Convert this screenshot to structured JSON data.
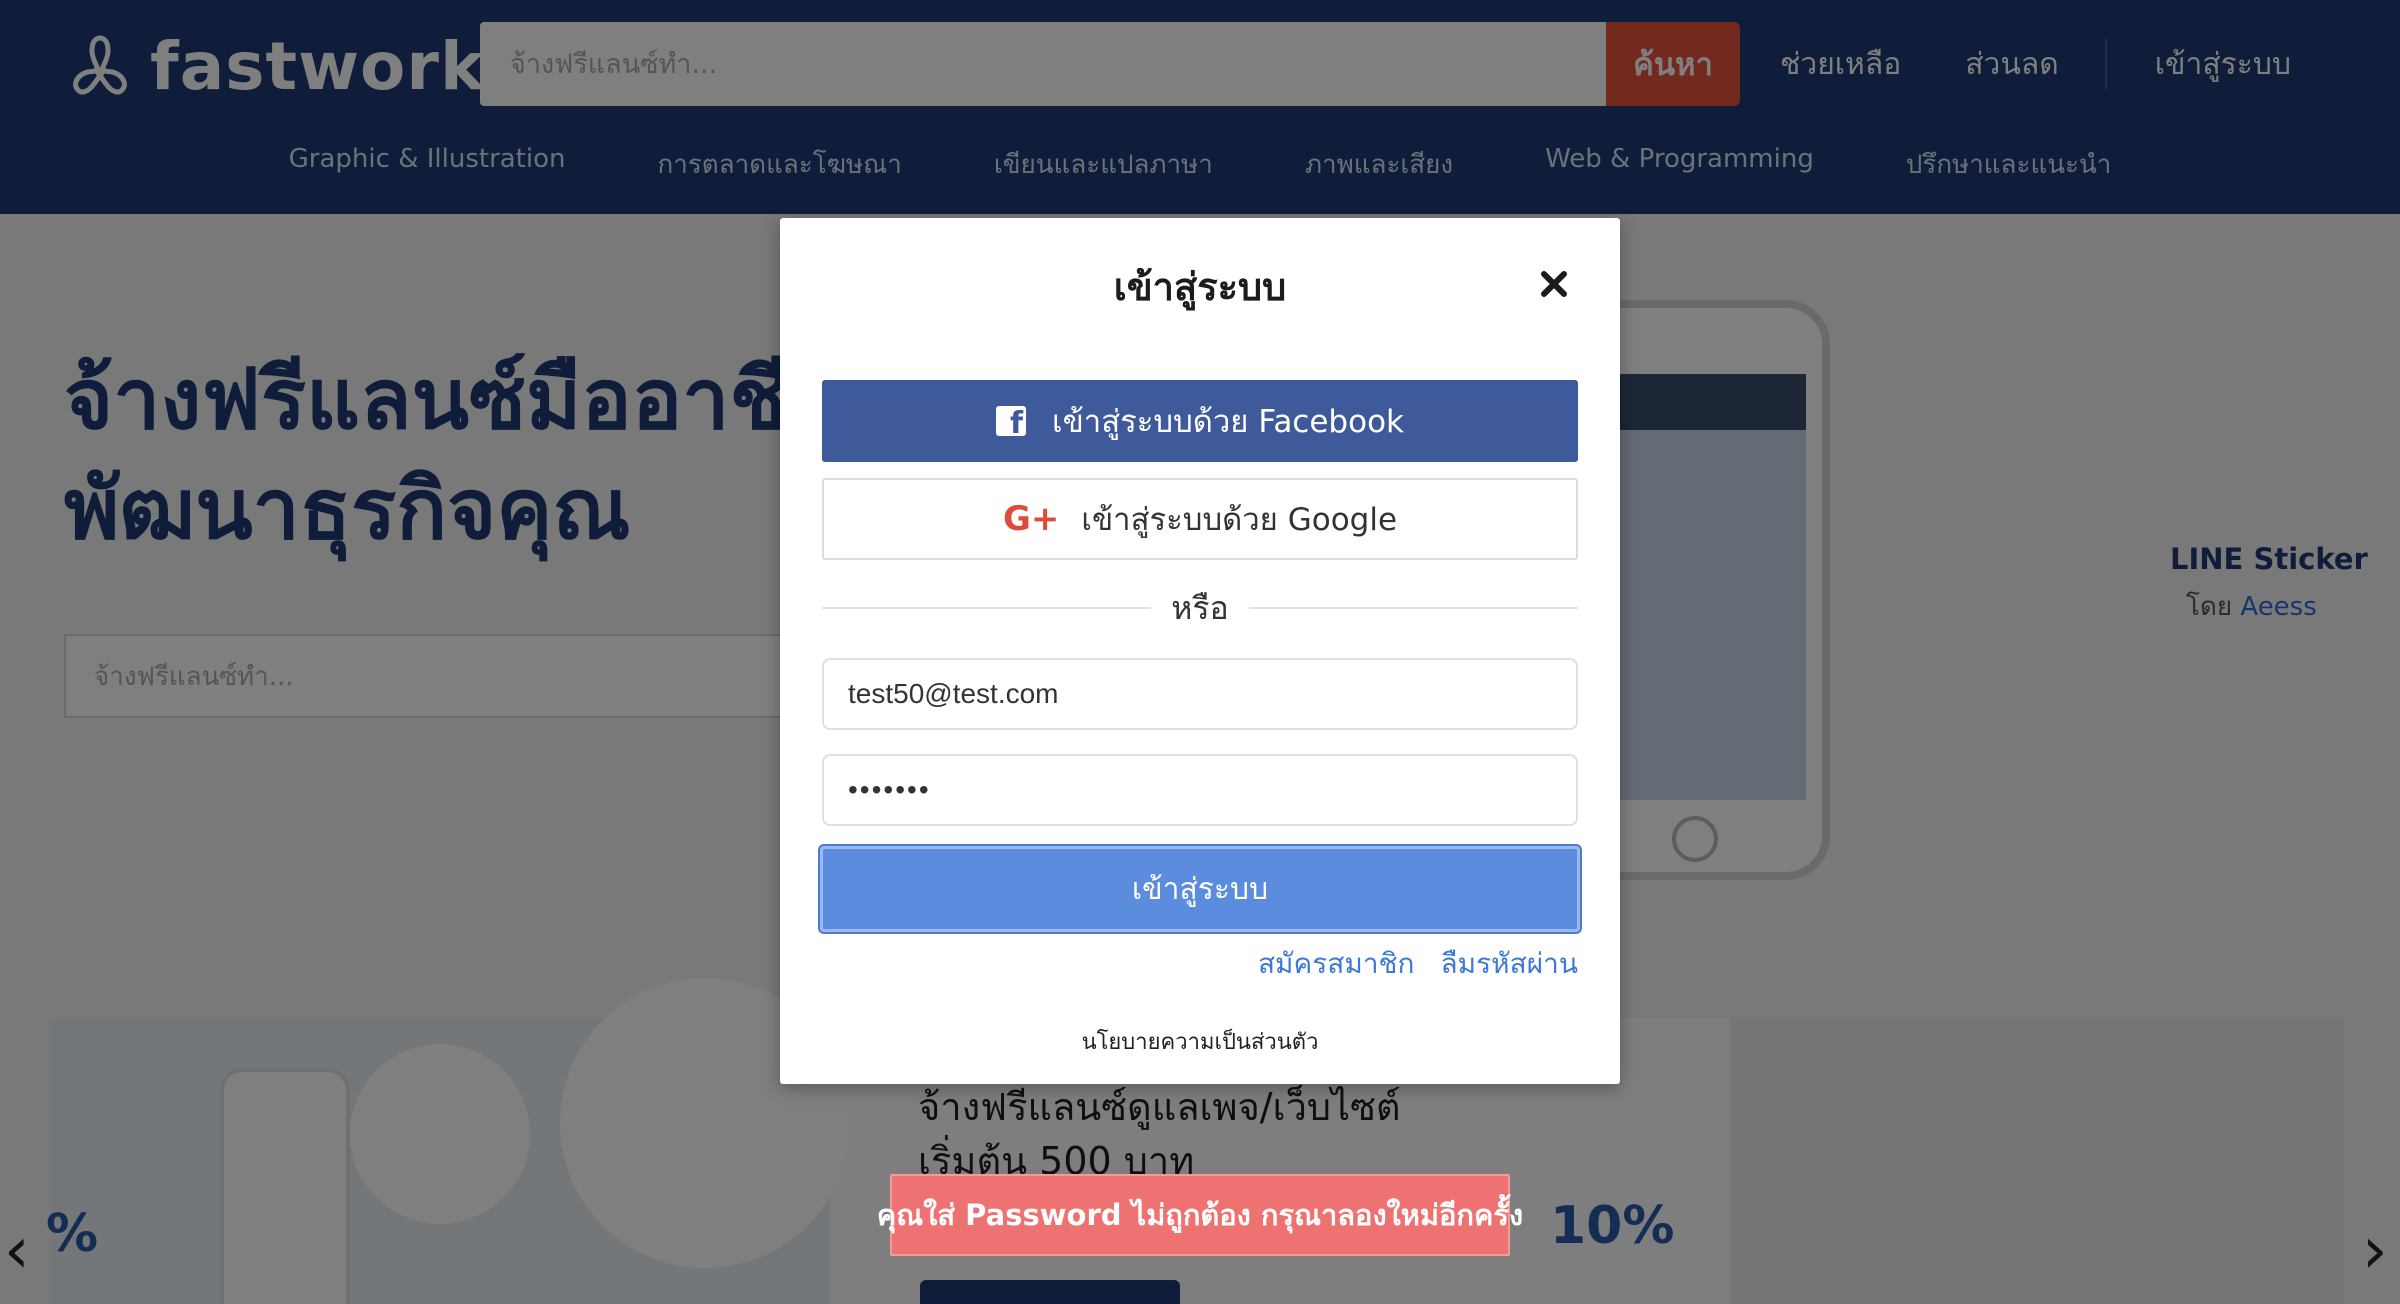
{
  "header": {
    "brand": "fastwork",
    "search_placeholder": "จ้างฟรีแลนซ์ทำ...",
    "search_button": "ค้นหา",
    "links": {
      "help": "ช่วยเหลือ",
      "discount": "ส่วนลด",
      "login": "เข้าสู่ระบบ"
    },
    "categories": [
      "Graphic & Illustration",
      "การตลาดและโฆษณา",
      "เขียนและแปลภาษา",
      "ภาพและเสียง",
      "Web & Programming",
      "ปรึกษาและแนะนำ"
    ]
  },
  "hero": {
    "title_line1": "จ้างฟรีแลนซ์มืออาชี",
    "title_line2": "พัฒนาธุรกิจคุณ",
    "search_placeholder": "จ้างฟรีแลนซ์ทำ...",
    "showcase": {
      "title": "LINE Sticker",
      "by_label": "โดย",
      "author": "Aeess"
    }
  },
  "banner": {
    "headline_line1": "จ้างฟรีแลนซ์ดูแลเพจ/เว็บไซต์",
    "headline_line2": "เริ่มต้น 500 บาท",
    "percent_right": "10%",
    "percent_left": "%",
    "prev_arrow": "‹",
    "next_arrow": "›"
  },
  "modal": {
    "title": "เข้าสู่ระบบ",
    "facebook_button": "เข้าสู่ระบบด้วย Facebook",
    "google_button": "เข้าสู่ระบบด้วย Google",
    "google_glyph": "G+",
    "facebook_glyph": "f",
    "divider_text": "หรือ",
    "email_value": "test50@test.com",
    "password_value": "•••••••",
    "submit_button": "เข้าสู่ระบบ",
    "register_link": "สมัครสมาชิก",
    "forgot_link": "ลืมรหัสผ่าน",
    "privacy_link": "นโยบายความเป็นส่วนตัว"
  },
  "toast": {
    "message": "คุณใส่ Password ไม่ถูกต้อง กรุณาลองใหม่อีกครั้ง"
  },
  "colors": {
    "header_bg": "#1f3a75",
    "search_button": "#e8533f",
    "facebook": "#3f5a9a",
    "google_icon": "#dd4b39",
    "submit": "#5b8cde",
    "link": "#3b78d8",
    "error_toast": "#ef7272"
  },
  "icons": {
    "logo": "fastwork-logo-icon",
    "close": "close-icon",
    "facebook": "facebook-icon",
    "google": "google-plus-icon"
  }
}
